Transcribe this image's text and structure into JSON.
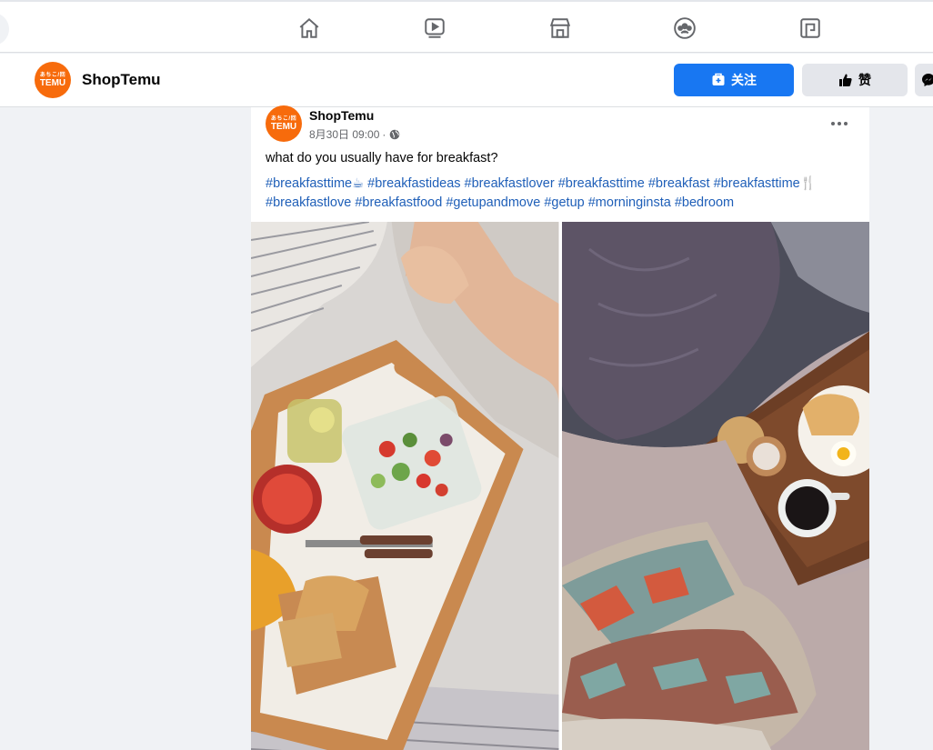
{
  "nav": {
    "icons": [
      "home-icon",
      "watch-icon",
      "marketplace-icon",
      "groups-icon",
      "gaming-icon"
    ]
  },
  "page": {
    "name": "ShopTemu",
    "logo_text_top": "あちこ/回",
    "logo_text": "TEMU",
    "follow_label": "关注",
    "like_label": "赞"
  },
  "post": {
    "author": "ShopTemu",
    "timestamp": "8月30日 09:00",
    "separator": "·",
    "audience_icon": "globe-icon",
    "text": "what do you usually have for breakfast?",
    "hashtags": [
      "#breakfasttime☕",
      "#breakfastideas",
      "#breakfastlover",
      "#breakfasttime",
      "#breakfast",
      "#breakfasttime🍴",
      "#breakfastlove",
      "#breakfastfood",
      "#getupandmove",
      "#getup",
      "#morninginsta",
      "#bedroom"
    ],
    "photos": [
      "breakfast-tray-photo-left",
      "breakfast-tray-photo-right"
    ]
  },
  "colors": {
    "accent": "#1877f2",
    "brand": "#f76b0c",
    "hashtag": "#1f5fb8"
  }
}
